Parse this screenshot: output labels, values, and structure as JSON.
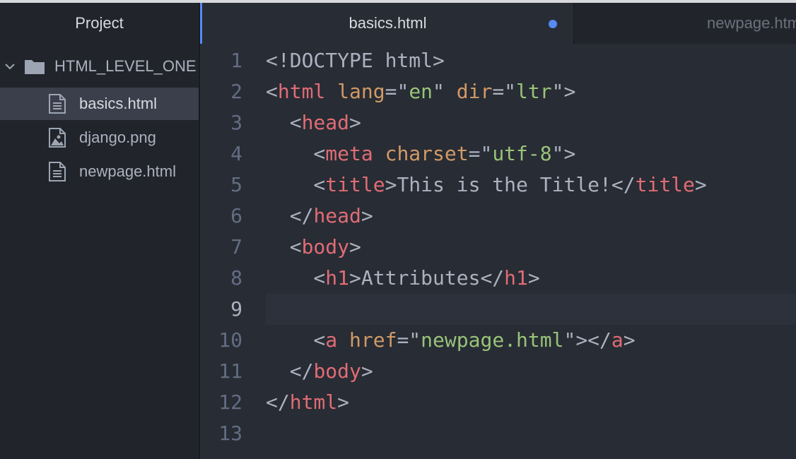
{
  "sidebar": {
    "title": "Project",
    "root_folder": "HTML_LEVEL_ONE",
    "files": [
      {
        "name": "basics.html",
        "icon": "file-text-icon",
        "selected": true
      },
      {
        "name": "django.png",
        "icon": "file-image-icon",
        "selected": false
      },
      {
        "name": "newpage.html",
        "icon": "file-text-icon",
        "selected": false
      }
    ]
  },
  "tabs": [
    {
      "label": "basics.html",
      "active": true,
      "modified": true
    },
    {
      "label": "newpage.html",
      "active": false,
      "modified": false
    }
  ],
  "editor": {
    "current_line": 9,
    "lines": [
      [
        {
          "c": "p",
          "t": "<!DOCTYPE html>"
        }
      ],
      [
        {
          "c": "p",
          "t": "<"
        },
        {
          "c": "t",
          "t": "html"
        },
        {
          "c": "p",
          "t": " "
        },
        {
          "c": "a",
          "t": "lang"
        },
        {
          "c": "p",
          "t": "=\""
        },
        {
          "c": "s",
          "t": "en"
        },
        {
          "c": "p",
          "t": "\" "
        },
        {
          "c": "a",
          "t": "dir"
        },
        {
          "c": "p",
          "t": "=\""
        },
        {
          "c": "s",
          "t": "ltr"
        },
        {
          "c": "p",
          "t": "\">"
        }
      ],
      [
        {
          "c": "p",
          "t": "  <"
        },
        {
          "c": "t",
          "t": "head"
        },
        {
          "c": "p",
          "t": ">"
        }
      ],
      [
        {
          "c": "p",
          "t": "    <"
        },
        {
          "c": "t",
          "t": "meta"
        },
        {
          "c": "p",
          "t": " "
        },
        {
          "c": "a",
          "t": "charset"
        },
        {
          "c": "p",
          "t": "=\""
        },
        {
          "c": "s",
          "t": "utf-8"
        },
        {
          "c": "p",
          "t": "\">"
        }
      ],
      [
        {
          "c": "p",
          "t": "    <"
        },
        {
          "c": "t",
          "t": "title"
        },
        {
          "c": "p",
          "t": ">This is the Title!</"
        },
        {
          "c": "t",
          "t": "title"
        },
        {
          "c": "p",
          "t": ">"
        }
      ],
      [
        {
          "c": "p",
          "t": "  </"
        },
        {
          "c": "t",
          "t": "head"
        },
        {
          "c": "p",
          "t": ">"
        }
      ],
      [
        {
          "c": "p",
          "t": "  <"
        },
        {
          "c": "t",
          "t": "body"
        },
        {
          "c": "p",
          "t": ">"
        }
      ],
      [
        {
          "c": "p",
          "t": "    <"
        },
        {
          "c": "t",
          "t": "h1"
        },
        {
          "c": "p",
          "t": ">Attributes</"
        },
        {
          "c": "t",
          "t": "h1"
        },
        {
          "c": "p",
          "t": ">"
        }
      ],
      [],
      [
        {
          "c": "p",
          "t": "    <"
        },
        {
          "c": "t",
          "t": "a"
        },
        {
          "c": "p",
          "t": " "
        },
        {
          "c": "a",
          "t": "href"
        },
        {
          "c": "p",
          "t": "=\""
        },
        {
          "c": "s",
          "t": "newpage.html"
        },
        {
          "c": "p",
          "t": "\"></"
        },
        {
          "c": "t",
          "t": "a"
        },
        {
          "c": "p",
          "t": ">"
        }
      ],
      [
        {
          "c": "p",
          "t": "  </"
        },
        {
          "c": "t",
          "t": "body"
        },
        {
          "c": "p",
          "t": ">"
        }
      ],
      [
        {
          "c": "p",
          "t": "</"
        },
        {
          "c": "t",
          "t": "html"
        },
        {
          "c": "p",
          "t": ">"
        }
      ],
      []
    ]
  },
  "colors": {
    "accent": "#568af2",
    "tag": "#e06c75",
    "attribute": "#d19a66",
    "string": "#98c379",
    "text": "#abb2bf"
  }
}
